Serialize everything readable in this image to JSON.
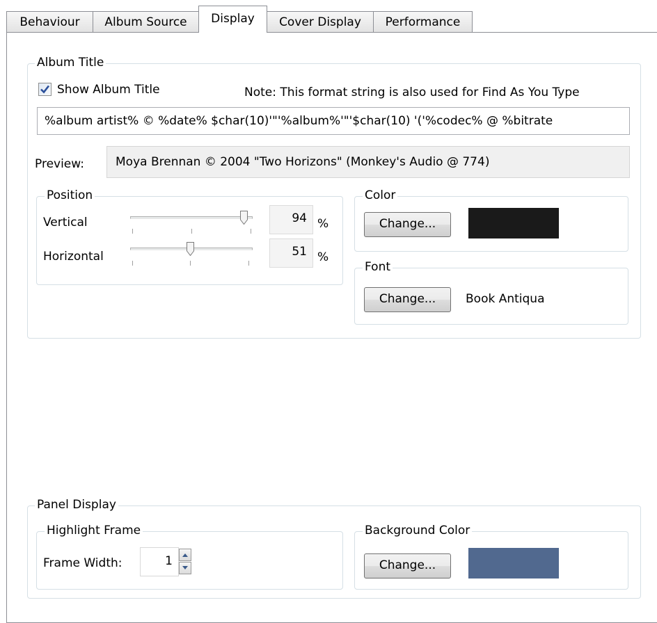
{
  "tabs": [
    {
      "label": "Behaviour"
    },
    {
      "label": "Album Source"
    },
    {
      "label": "Display"
    },
    {
      "label": "Cover Display"
    },
    {
      "label": "Performance"
    }
  ],
  "active_tab": "Display",
  "album_title": {
    "group_label": "Album Title",
    "show_checkbox_label": "Show Album Title",
    "show_checked": true,
    "note": "Note: This format string is also used for Find As You Type",
    "format_string": "%album artist% © %date% $char(10)'\"'%album%'\"'$char(10) '('%codec% @ %bitrate",
    "preview_label": "Preview:",
    "preview_value": "Moya Brennan © 2004 \"Two Horizons\" (Monkey's Audio @ 774)"
  },
  "position": {
    "group_label": "Position",
    "vertical_label": "Vertical",
    "vertical_value": "94",
    "vertical_level": 0.94,
    "horizontal_label": "Horizontal",
    "horizontal_value": "51",
    "horizontal_level": 0.51,
    "unit": "%"
  },
  "color": {
    "group_label": "Color",
    "change_label": "Change...",
    "swatch": "#1a1a1a"
  },
  "font": {
    "group_label": "Font",
    "change_label": "Change...",
    "font_name": "Book Antiqua"
  },
  "panel_display": {
    "group_label": "Panel Display",
    "highlight_frame_label": "Highlight Frame",
    "frame_width_label": "Frame Width:",
    "frame_width_value": "1",
    "background_color_label": "Background Color",
    "change_label": "Change...",
    "background_swatch": "#51698f"
  }
}
